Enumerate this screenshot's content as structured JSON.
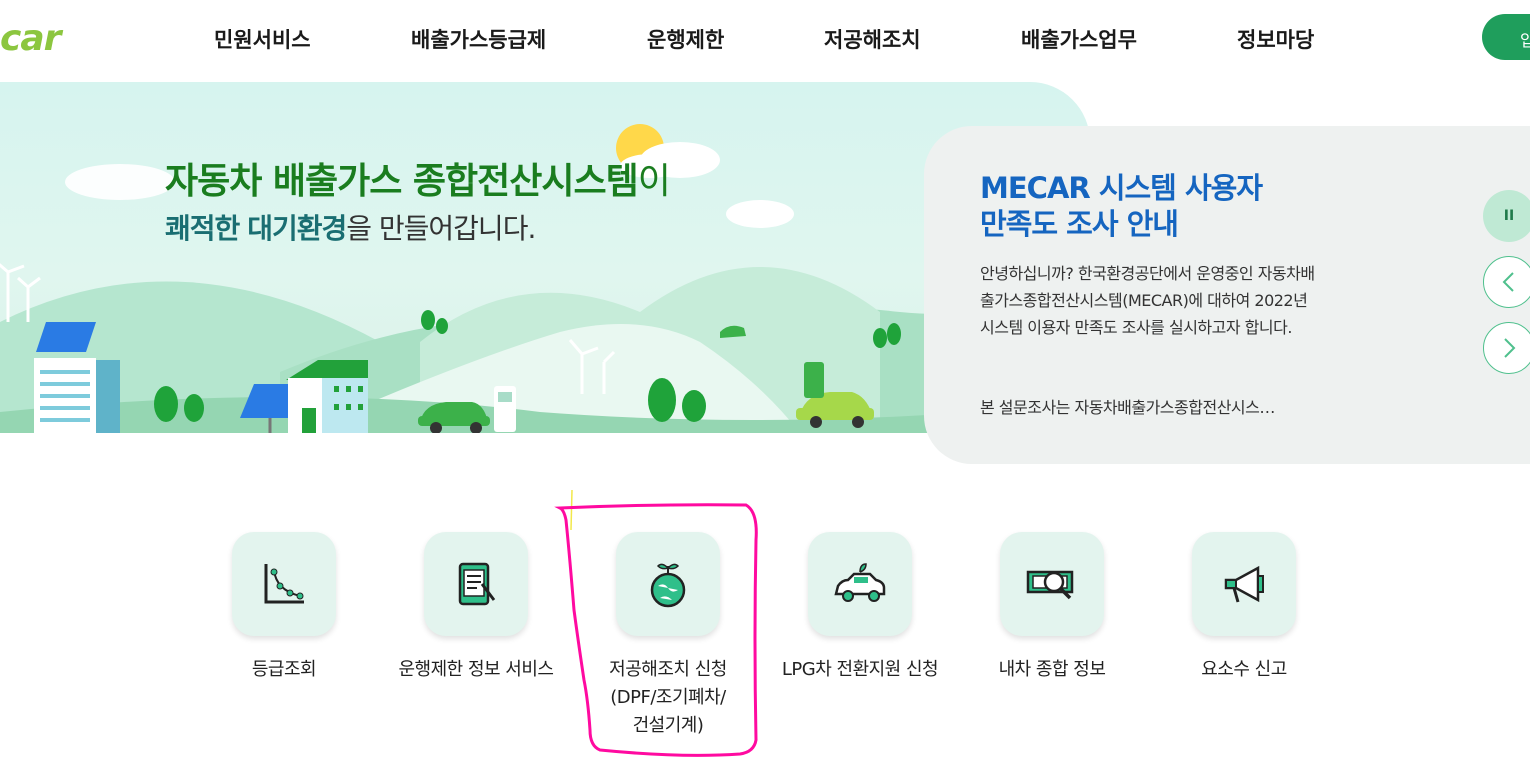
{
  "header": {
    "logo_text": "car",
    "nav": [
      "민원서비스",
      "배출가스등급제",
      "운행제한",
      "저공해조치",
      "배출가스업무",
      "정보마당"
    ],
    "right_button": "입"
  },
  "hero": {
    "title_main": "자동차 배출가스 종합전산시스템",
    "title_suffix": "이",
    "sub_em1": "쾌적한",
    "sub_em2": "대기환경",
    "sub_rest1": " ",
    "sub_rest2": "을 만들어갑니다."
  },
  "notice": {
    "title_line1": "MECAR 시스템 사용자",
    "title_line2": "만족도 조사 안내",
    "body": "안녕하십니까? 한국환경공단에서 운영중인 자동차배출가스종합전산시스템(MECAR)에 대하여 2022년 시스템 이용자 만족도 조사를 실시하고자 합니다.",
    "more": "본 설문조사는 자동차배출가스종합전산시스…",
    "pause_label": "II"
  },
  "quick_menu": [
    {
      "label_lines": [
        "등급조회"
      ],
      "icon": "grade-chart-icon"
    },
    {
      "label_lines": [
        "운행제한 정보 서비스"
      ],
      "icon": "tablet-info-icon"
    },
    {
      "label_lines": [
        "저공해조치 신청",
        "(DPF/조기폐차/",
        "건설기계)"
      ],
      "icon": "earth-sprout-icon"
    },
    {
      "label_lines": [
        "LPG차 전환지원 신청"
      ],
      "icon": "eco-car-icon"
    },
    {
      "label_lines": [
        "내차 종합 정보"
      ],
      "icon": "money-search-icon"
    },
    {
      "label_lines": [
        "요소수 신고"
      ],
      "icon": "megaphone-icon"
    }
  ],
  "colors": {
    "accent_green": "#1f9e5c",
    "title_green": "#1a7d1f",
    "notice_blue": "#1565c0",
    "annotation_magenta": "#ff0aa0"
  }
}
